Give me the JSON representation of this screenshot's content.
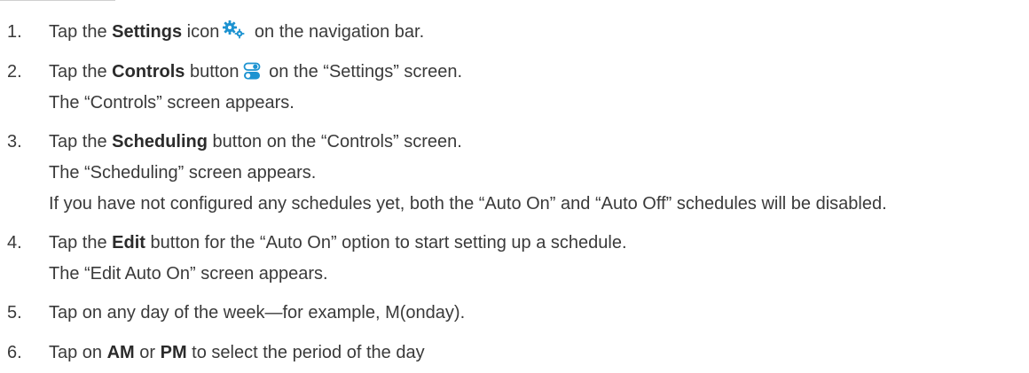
{
  "steps": [
    {
      "number": "1.",
      "pre": "Tap the ",
      "bold": "Settings",
      "post_before_icon": " icon",
      "icon": "gear-icon",
      "post": " on the navigation bar."
    },
    {
      "number": "2.",
      "pre": "Tap the ",
      "bold": "Controls",
      "post_before_icon": " button",
      "icon": "toggle-icon",
      "post": " on the “Settings” screen.",
      "notes": [
        "The “Controls” screen appears."
      ]
    },
    {
      "number": "3.",
      "pre": "Tap the ",
      "bold": "Scheduling",
      "post": " button on the “Controls” screen.",
      "notes": [
        "The “Scheduling” screen appears.",
        "If you have not configured any schedules yet, both the “Auto On” and “Auto Off” schedules will be disabled."
      ]
    },
    {
      "number": "4.",
      "pre": "Tap the ",
      "bold": "Edit",
      "post": " button for the “Auto On” option to start setting up a schedule.",
      "notes": [
        "The “Edit Auto On” screen appears."
      ]
    },
    {
      "number": "5.",
      "text": "Tap on any day of the week—for example, M(onday)."
    },
    {
      "number": "6.",
      "pre": "Tap on ",
      "bold": "AM",
      "mid": " or ",
      "bold2": "PM",
      "post": " to select the period of the day"
    }
  ],
  "colors": {
    "icon_blue": "#1d93d1",
    "text": "#3a3a3a"
  }
}
